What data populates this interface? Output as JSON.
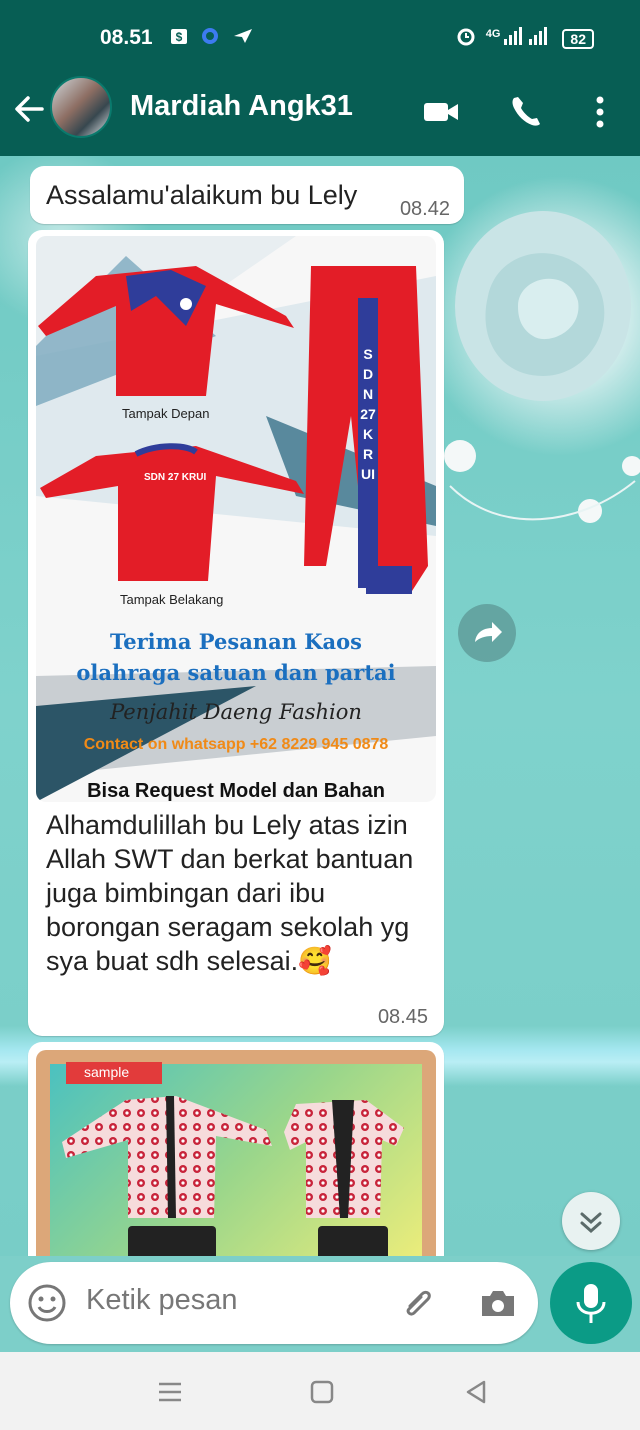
{
  "status": {
    "time": "08.51",
    "network": "4G",
    "battery": "82"
  },
  "header": {
    "title": "Mardiah Angk31"
  },
  "messages": [
    {
      "text": "Assalamu'alaikum bu Lely",
      "time": "08.42"
    },
    {
      "image": {
        "label_front": "Tampak Depan",
        "label_back": "Tampak Belakang",
        "pants_text": "SDN 27 KRUI",
        "shirt_print": "SDN 27 KRUI",
        "headline1": "Terima Pesanan Kaos",
        "headline2": "olahraga satuan dan partai",
        "brand": "Penjahit Daeng Fashion",
        "contact": "Contact on whatsapp +62 8229 945 0878",
        "footer": "Bisa Request Model dan Bahan"
      },
      "text": "Alhamdulillah bu Lely atas izin Allah SWT dan berkat bantuan juga bimbingan dari ibu borongan seragam sekolah yg sya buat sdh selesai.🥰",
      "time": "08.45"
    },
    {
      "image": {
        "tag": "sample"
      }
    }
  ],
  "composer": {
    "placeholder": "Ketik pesan"
  },
  "colors": {
    "header": "#075e54",
    "accent": "#0b9b86",
    "bubble": "#ffffff"
  }
}
